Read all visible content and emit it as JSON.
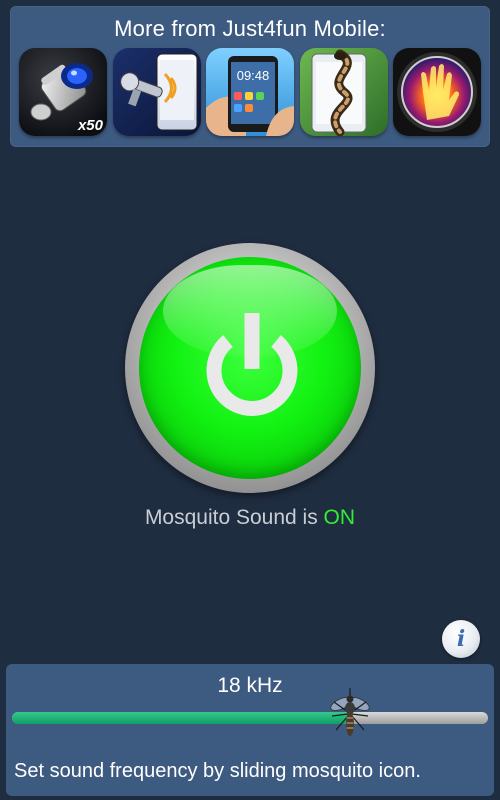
{
  "promo": {
    "title": "More from Just4fun Mobile:",
    "apps": [
      {
        "icon": "magnifier-camera-icon",
        "badge": "x50"
      },
      {
        "icon": "door-key-wifi-icon"
      },
      {
        "icon": "phone-in-hand-icon",
        "clock": "09:48"
      },
      {
        "icon": "snake-on-phone-icon"
      },
      {
        "icon": "thermal-hand-icon"
      }
    ]
  },
  "power": {
    "icon": "power-icon",
    "color": "#12f212",
    "status_prefix": "Mosquito Sound is ",
    "status_value": "ON",
    "status_color": "#33ee33"
  },
  "info": {
    "label": "i",
    "icon": "info-icon"
  },
  "frequency": {
    "value_label": "18 kHz",
    "level_fraction": 0.71,
    "fill_color": "#0f9e63",
    "thumb_icon": "mosquito-icon",
    "hint": "Set sound frequency by sliding mosquito icon."
  }
}
